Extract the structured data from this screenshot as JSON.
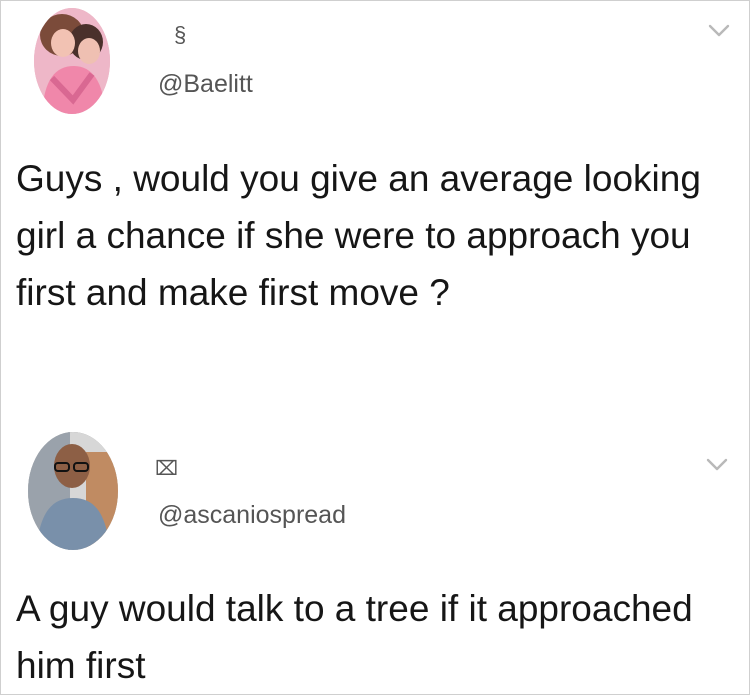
{
  "tweets": [
    {
      "name_glyph": "§",
      "handle": "@Baelitt",
      "text": "Guys , would you give an average looking girl a chance if she were to approach you first and make first move ?",
      "avatar_icon": "profile-photo-icon",
      "menu_icon": "chevron-down-icon"
    },
    {
      "name_glyph": "⌧",
      "handle": "@ascaniospread",
      "text": "A guy would talk to a tree if it approached him first",
      "avatar_icon": "profile-photo-icon",
      "menu_icon": "chevron-down-icon"
    }
  ],
  "colors": {
    "background": "#ffffff",
    "text": "#161616",
    "handle": "#555555",
    "chevron": "#b9b9b9"
  }
}
